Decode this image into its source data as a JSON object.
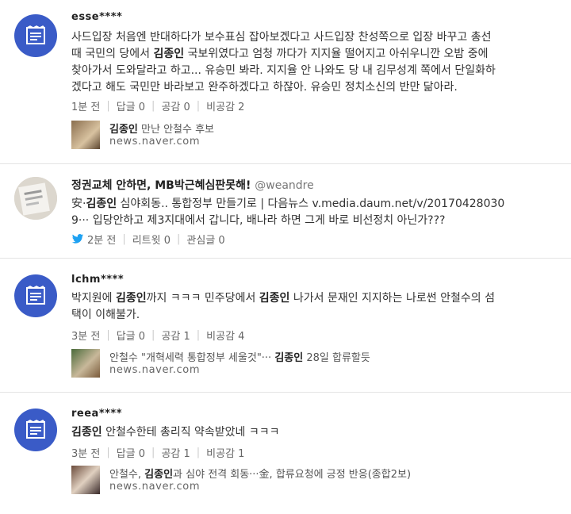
{
  "comments": [
    {
      "user": "esse****",
      "text_lines": [
        [
          "사드입장 처음엔 반대하다가 보수표심 잡아보겠다고 사드입장 찬성쪽으로 입장 바꾸고 총선"
        ],
        [
          "때 국민의 당에서 ",
          {
            "b": "김종인"
          },
          " 국보위였다고 엄청 까다가 지지율 떨어지고 아쉬우니깐 오밤 중에"
        ],
        [
          "찾아가서 도와달라고 하고... 유승민 봐라. 지지율 안 나와도 당 내 김무성계 쪽에서 단일화하"
        ],
        [
          "겠다고 해도 국민만 바라보고 완주하겠다고 하잖아. 유승민 정치소신의 반만 닮아라."
        ]
      ],
      "time": "1분 전",
      "reply": "답글 0",
      "like": "공감 0",
      "dislike": "비공감 2",
      "news_title_parts": [
        {
          "b": "김종인"
        },
        " 만난 안철수 후보"
      ],
      "news_source": "news.naver.com"
    },
    {
      "twitter_title": "정권교체 안하면, MB박근혜심판못해!",
      "twitter_handle": "@weandre",
      "text_lines": [
        [
          "安·",
          {
            "b": "김종인"
          },
          " 심야회동.. 통합정부 만들기로 | 다음뉴스 v.media.daum.net/v/20170428030"
        ],
        [
          "9··· 입당안하고 제3지대에서 갑니다, 배나라 하면 그게 바로 비선정치 아닌가???"
        ]
      ],
      "time": "2분 전",
      "retweet": "리트윗 0",
      "fav": "관심글 0"
    },
    {
      "user": "lchm****",
      "text_lines": [
        [
          "박지원에 ",
          {
            "b": "김종인"
          },
          "까지 ㅋㅋㅋ 민주당에서 ",
          {
            "b": "김종인"
          },
          " 나가서 문재인 지지하는 나로썬 안철수의 섬"
        ],
        [
          "택이 이해불가."
        ]
      ],
      "time": "3분 전",
      "reply": "답글 0",
      "like": "공감 1",
      "dislike": "비공감 4",
      "news_title_parts": [
        "안철수 \"개혁세력 통합정부 세울것\"··· ",
        {
          "b": "김종인"
        },
        " 28일 합류할듯"
      ],
      "news_source": "news.naver.com"
    },
    {
      "user": "reea****",
      "text_lines": [
        [
          {
            "b": "김종인"
          },
          " 안철수한테 총리직 약속받았네 ㅋㅋㅋ"
        ]
      ],
      "time": "3분 전",
      "reply": "답글 0",
      "like": "공감 1",
      "dislike": "비공감 1",
      "news_title_parts": [
        "안철수, ",
        {
          "b": "김종인"
        },
        "과 심야 전격 회동···金, 합류요청에 긍정 반응(종합2보)"
      ],
      "news_source": "news.naver.com"
    }
  ],
  "colors": {
    "naver_avatar": "#3a5bc7",
    "twitter_bird": "#1da1f2"
  },
  "icons": {
    "naver_avatar": "naver-blog-icon",
    "twitter": "twitter-bird-icon"
  }
}
